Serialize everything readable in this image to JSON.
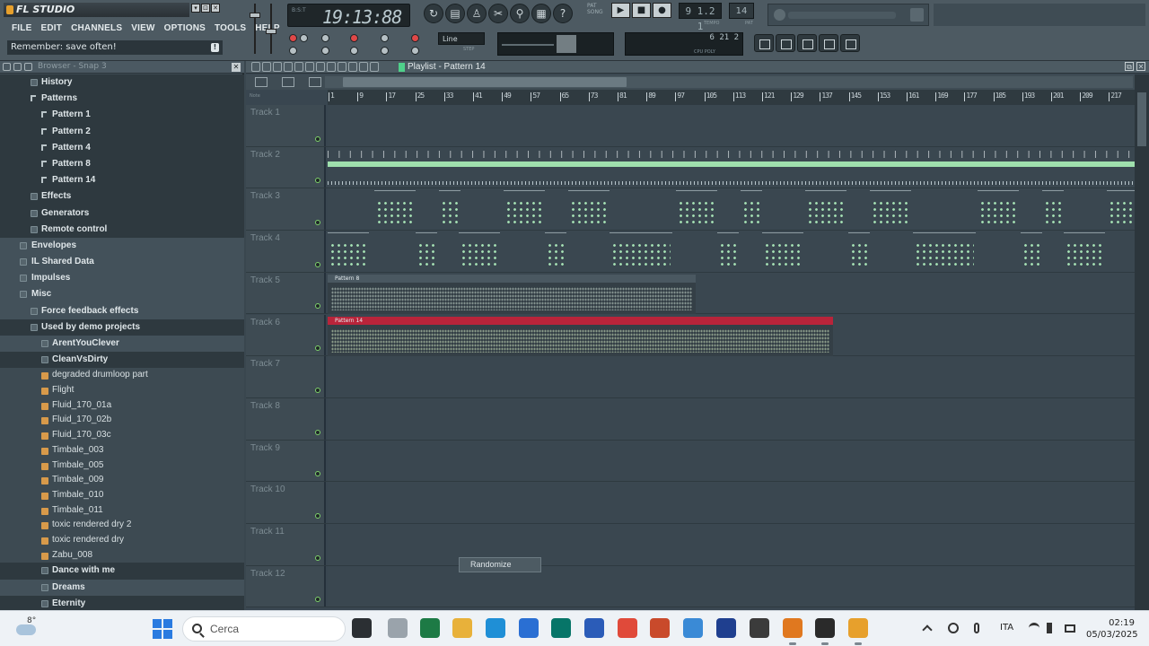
{
  "app": {
    "logo": "FL STUDIO",
    "window_buttons": [
      "▾",
      "⊡",
      "✕"
    ],
    "menu": [
      "FILE",
      "EDIT",
      "CHANNELS",
      "VIEW",
      "OPTIONS",
      "TOOLS",
      "HELP"
    ],
    "hint": "Remember: save often!",
    "hint_icon": "!"
  },
  "transport": {
    "time": "19:13:88",
    "time_mode": "B:S:T",
    "pat_label": "PAT",
    "song_label": "SONG",
    "play_icon": "▶",
    "stop_icon": "■",
    "rec_icon": "●",
    "tempo": "9 1.2 1",
    "tempo_label": "TEMPO",
    "pattern_num": "14",
    "pattern_label": "PAT",
    "snap": "Line",
    "step_label": "STEP",
    "meters": "6 21 2",
    "meters_label": "CPU POLY"
  },
  "browser": {
    "title": "Browser - Snap 3",
    "close": "✕",
    "items": [
      {
        "label": "History",
        "level": 1,
        "kind": "folder",
        "style": "dark",
        "bold": true
      },
      {
        "label": "Patterns",
        "level": 1,
        "kind": "note",
        "style": "dark",
        "bold": true
      },
      {
        "label": "Pattern 1",
        "level": 2,
        "kind": "note",
        "style": "dark",
        "bold": true
      },
      {
        "label": "Pattern 2",
        "level": 2,
        "kind": "note",
        "style": "dark",
        "bold": true
      },
      {
        "label": "Pattern 4",
        "level": 2,
        "kind": "note",
        "style": "dark",
        "bold": true
      },
      {
        "label": "Pattern 8",
        "level": 2,
        "kind": "note",
        "style": "dark",
        "bold": true
      },
      {
        "label": "Pattern 14",
        "level": 2,
        "kind": "note",
        "style": "dark",
        "bold": true
      },
      {
        "label": "Effects",
        "level": 1,
        "kind": "folder",
        "style": "dark",
        "bold": true
      },
      {
        "label": "Generators",
        "level": 1,
        "kind": "folder",
        "style": "dark",
        "bold": true
      },
      {
        "label": "Remote control",
        "level": 1,
        "kind": "folder",
        "style": "dark",
        "bold": true
      },
      {
        "label": "Envelopes",
        "level": 0,
        "kind": "folder",
        "style": "light",
        "bold": true
      },
      {
        "label": "IL Shared Data",
        "level": 0,
        "kind": "folder",
        "style": "light",
        "bold": true
      },
      {
        "label": "Impulses",
        "level": 0,
        "kind": "folder",
        "style": "light",
        "bold": true
      },
      {
        "label": "Misc",
        "level": 0,
        "kind": "folder",
        "style": "light",
        "bold": true
      },
      {
        "label": "Force feedback effects",
        "level": 1,
        "kind": "folder",
        "style": "light",
        "bold": true
      },
      {
        "label": "Used by demo projects",
        "level": 1,
        "kind": "folder",
        "style": "dark",
        "bold": true
      },
      {
        "label": "ArentYouClever",
        "level": 2,
        "kind": "folder",
        "style": "light",
        "bold": true
      },
      {
        "label": "CleanVsDirty",
        "level": 2,
        "kind": "folder",
        "style": "dark",
        "bold": true
      }
    ],
    "files": [
      "degraded drumloop part",
      "Flight",
      "Fluid_170_01a",
      "Fluid_170_02b",
      "Fluid_170_03c",
      "Timbale_003",
      "Timbale_005",
      "Timbale_009",
      "Timbale_010",
      "Timbale_011",
      "toxic rendered dry 2",
      "toxic rendered dry",
      "Zabu_008"
    ],
    "more": [
      {
        "label": "Dance with me",
        "level": 2
      },
      {
        "label": "Dreams",
        "level": 2
      },
      {
        "label": "Eternity",
        "level": 2
      }
    ]
  },
  "playlist": {
    "title": "Playlist - Pattern 14",
    "mini_label": "Note",
    "ruler": [
      "1",
      "9",
      "17",
      "25",
      "33",
      "41",
      "49",
      "57",
      "65",
      "73",
      "81",
      "89",
      "97",
      "105",
      "113",
      "121",
      "129",
      "137",
      "145",
      "153",
      "161",
      "169",
      "177",
      "185",
      "193",
      "201",
      "209",
      "217"
    ],
    "tracks": [
      "Track 1",
      "Track 2",
      "Track 3",
      "Track 4",
      "Track 5",
      "Track 6",
      "Track 7",
      "Track 8",
      "Track 9",
      "Track 10",
      "Track 11",
      "Track 12"
    ],
    "clips": {
      "pattern8": "Pattern 8",
      "pattern14": "Pattern 14"
    },
    "context_menu": "Randomize",
    "win_buttons": [
      "⧉",
      "✕"
    ]
  },
  "taskbar": {
    "weather": "8°",
    "search_placeholder": "Cerca",
    "lang": "ITA",
    "time": "02:19",
    "date": "05/03/2025",
    "apps": [
      {
        "name": "task-view-icon",
        "color": "#2b2f33"
      },
      {
        "name": "pen-icon",
        "color": "#9aa3ab"
      },
      {
        "name": "excel-icon",
        "color": "#1d7a45"
      },
      {
        "name": "file-explorer-icon",
        "color": "#e8b13a"
      },
      {
        "name": "edge-icon",
        "color": "#1f8fd6"
      },
      {
        "name": "store-icon",
        "color": "#2a6fd3"
      },
      {
        "name": "publisher-icon",
        "color": "#077568"
      },
      {
        "name": "word-icon",
        "color": "#2b5cb8"
      },
      {
        "name": "chrome-icon",
        "color": "#e04a3a"
      },
      {
        "name": "powerpoint-icon",
        "color": "#c94a2b"
      },
      {
        "name": "notepad-icon",
        "color": "#3a8ad6"
      },
      {
        "name": "headphones-app-icon",
        "color": "#1f3f8f"
      },
      {
        "name": "star-app-icon",
        "color": "#3b3b3b"
      },
      {
        "name": "search-app-icon",
        "color": "#e0781f"
      },
      {
        "name": "record-app-icon",
        "color": "#2a2a2a"
      },
      {
        "name": "fl-studio-icon",
        "color": "#e7a02c"
      }
    ]
  },
  "colors": {
    "clip_green": "#a7e3b5",
    "pattern14_header": "#b8243a",
    "accent": "#4fd08a"
  }
}
